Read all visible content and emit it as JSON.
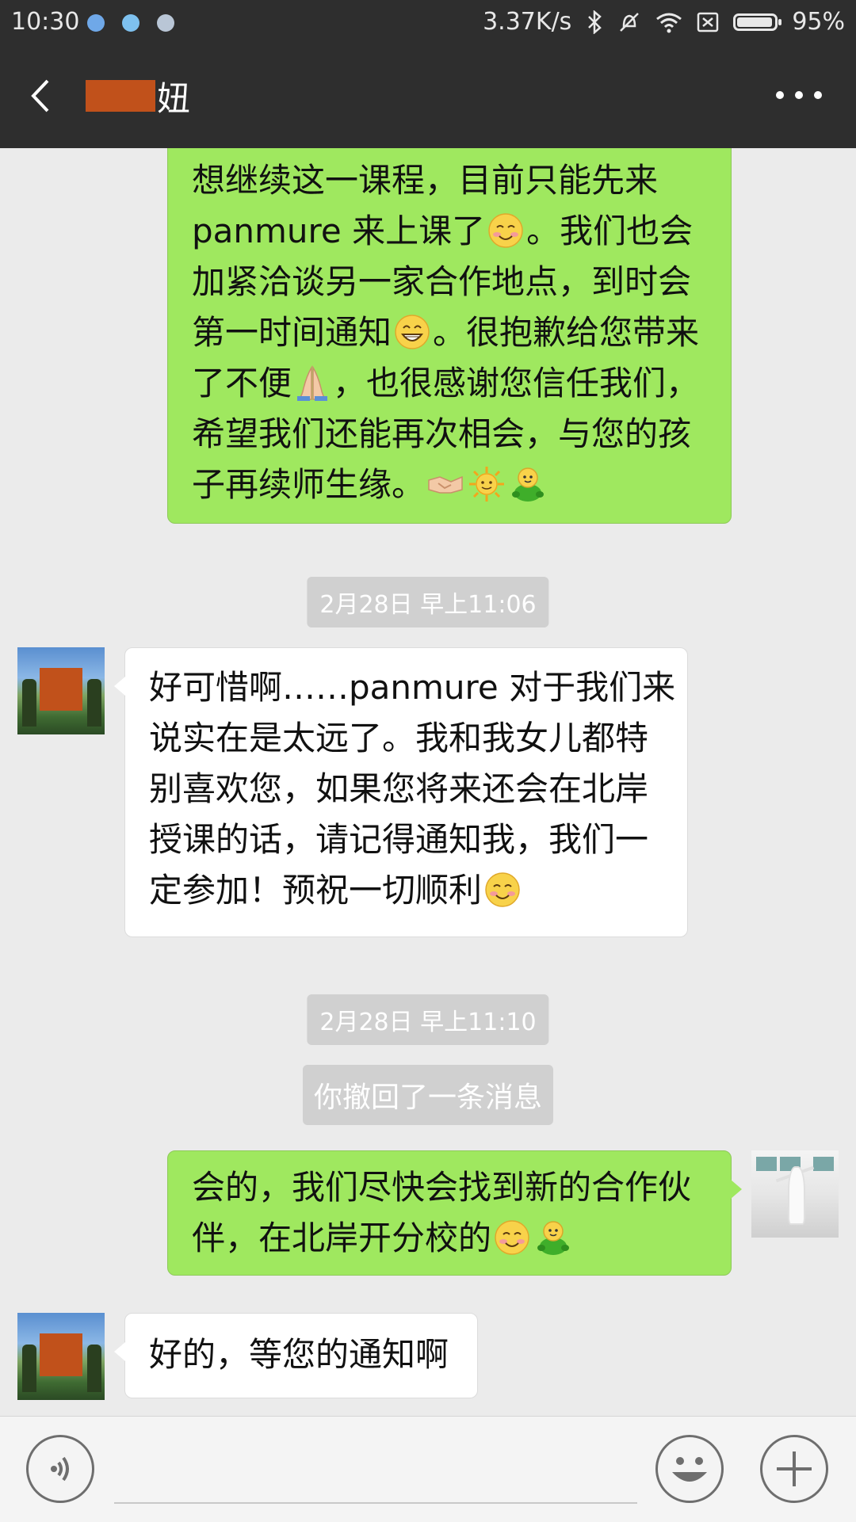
{
  "status_bar": {
    "time": "10:30",
    "network_speed": "3.37K/s",
    "battery_percent": "95%",
    "icons": [
      "k-app-icon",
      "cloud-icon",
      "message-icon",
      "bluetooth-icon",
      "mute-icon",
      "wifi-icon",
      "no-sim-icon",
      "battery-icon"
    ]
  },
  "header": {
    "title": "妞",
    "back_icon": "back-arrow-icon",
    "more_icon": "more-dots-icon"
  },
  "messages": [
    {
      "sender": "me",
      "lines": [
        [
          {
            "t": "想继续这一课程，目前只能先来"
          }
        ],
        [
          {
            "t": "panmure 来上课了"
          },
          {
            "e": "smile"
          },
          {
            "t": "。我们也会"
          }
        ],
        [
          {
            "t": "加紧洽谈另一家合作地点，到时会"
          }
        ],
        [
          {
            "t": "第一时间通知"
          },
          {
            "e": "grin"
          },
          {
            "t": "。很抱歉给您带来"
          }
        ],
        [
          {
            "t": "了不便"
          },
          {
            "e": "pray"
          },
          {
            "t": "，也很感谢您信任我们，"
          }
        ],
        [
          {
            "t": "希望我们还能再次相会，与您的孩"
          }
        ],
        [
          {
            "t": "子再续师生缘。"
          },
          {
            "e": "handshake"
          },
          {
            "e": "sun"
          },
          {
            "e": "frog"
          }
        ]
      ]
    },
    {
      "sender": "other",
      "lines": [
        [
          {
            "t": "好可惜啊……panmure 对于我们来"
          }
        ],
        [
          {
            "t": "说实在是太远了。我和我女儿都特"
          }
        ],
        [
          {
            "t": "别喜欢您，如果您将来还会在北岸"
          }
        ],
        [
          {
            "t": "授课的话，请记得通知我，我们一"
          }
        ],
        [
          {
            "t": "定参加！预祝一切顺利"
          },
          {
            "e": "smile"
          }
        ]
      ]
    },
    {
      "sender": "me",
      "lines": [
        [
          {
            "t": "会的，我们尽快会找到新的合作伙"
          }
        ],
        [
          {
            "t": "伴，在北岸开分校的"
          },
          {
            "e": "smile"
          },
          {
            "e": "frog"
          }
        ]
      ]
    },
    {
      "sender": "other",
      "lines": [
        [
          {
            "t": "好的，等您的通知啊"
          }
        ]
      ]
    }
  ],
  "timestamps": [
    "2月28日 早上11:06",
    "2月28日 早上11:10"
  ],
  "system_note": "你撤回了一条消息",
  "input_bar": {
    "voice_icon": "voice-icon",
    "emoji_icon": "emoji-face-icon",
    "plus_icon": "plus-icon"
  },
  "colors": {
    "bar_bg": "#2e2e2e",
    "chat_bg": "#ebebeb",
    "my_bubble": "#9fe85f",
    "other_bubble": "#ffffff",
    "redaction": "#c1511b"
  }
}
